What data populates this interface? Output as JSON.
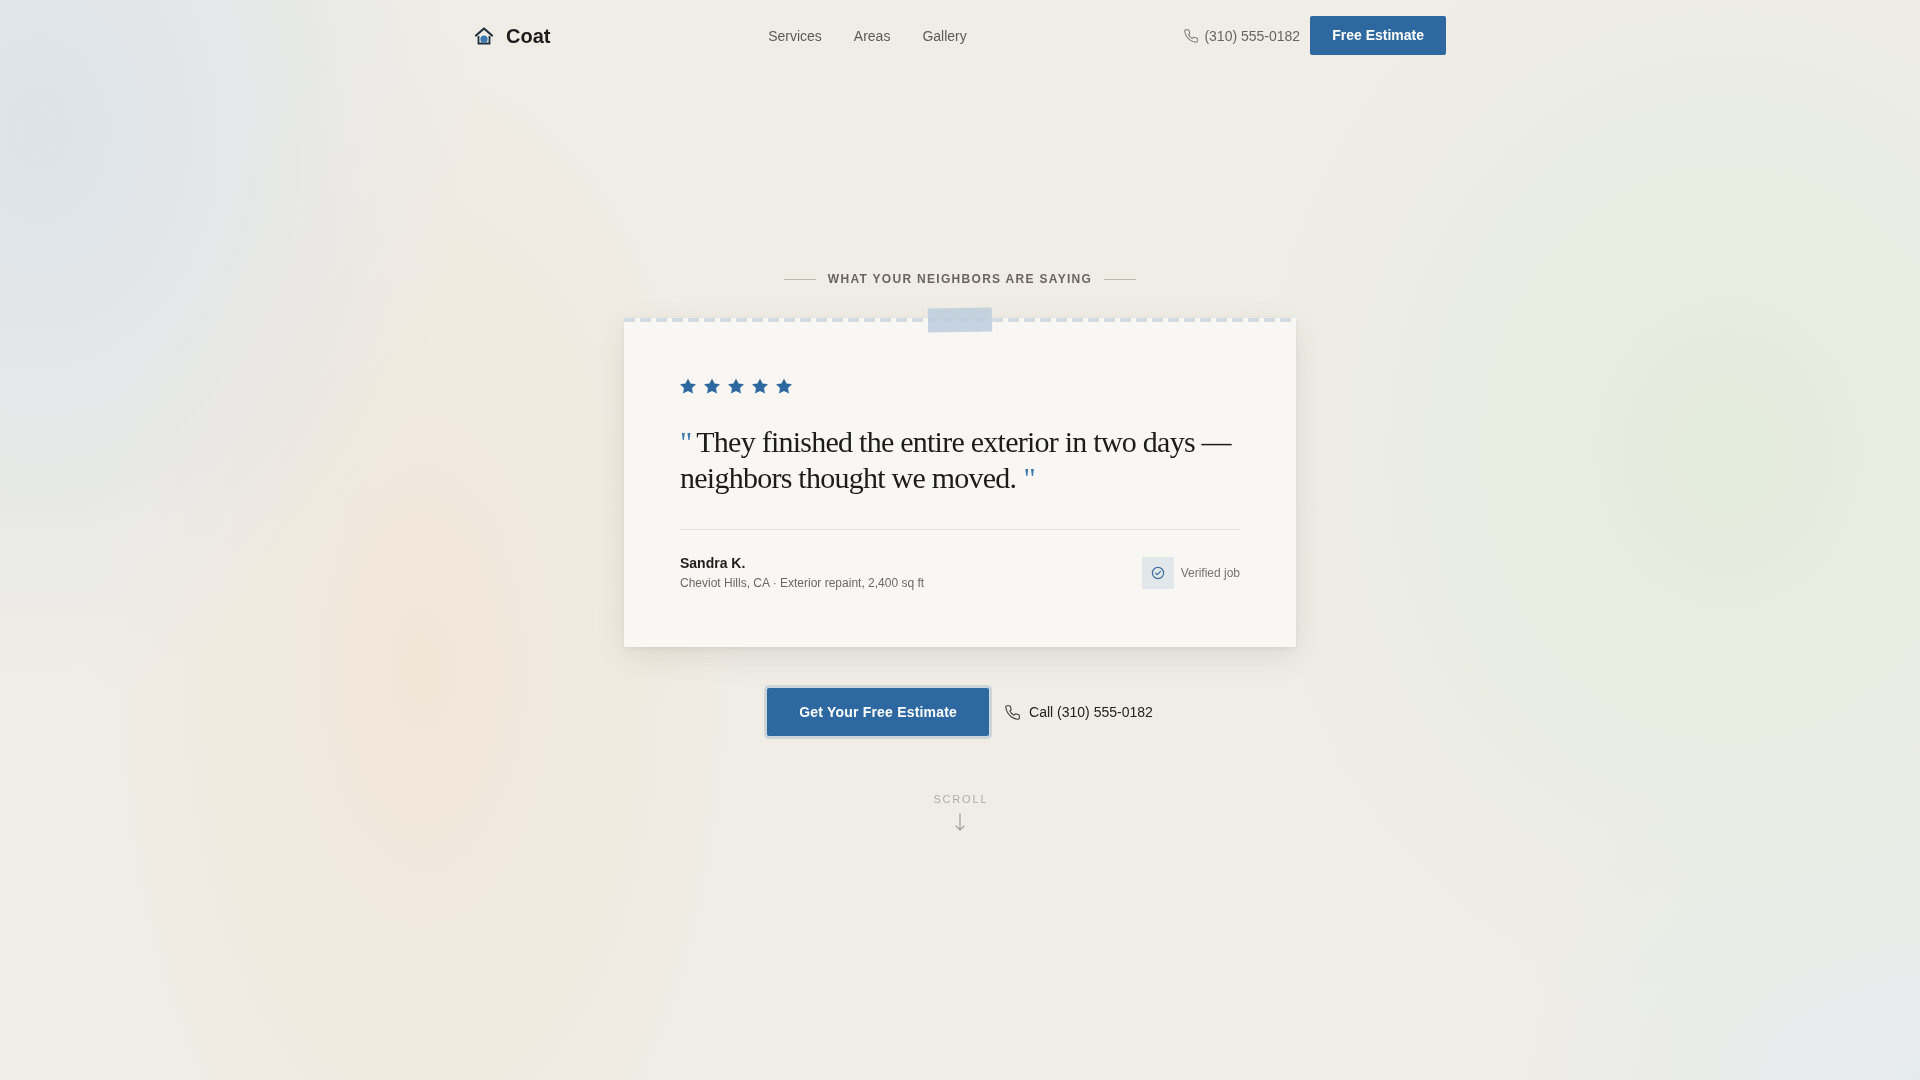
{
  "header": {
    "logo": "Coat",
    "nav": [
      "Services",
      "Areas",
      "Gallery"
    ],
    "phone": "(310) 555-0182",
    "button": "Free Estimate"
  },
  "testimonial": {
    "eyebrow": "WHAT YOUR NEIGHBORS ARE SAYING",
    "stars": 5,
    "quote_open": "\"",
    "quote": "They finished the entire exterior in two days — neighbors thought we moved.",
    "quote_close": "\"",
    "author": "Sandra K.",
    "details": "Cheviot Hills, CA · Exterior repaint, 2,400 sq ft",
    "badge": "Verified job"
  },
  "actions": {
    "primary_button": "Get Your Free Estimate",
    "call_link": "Call (310) 555-0182"
  },
  "scroll_hint": "SCROLL"
}
